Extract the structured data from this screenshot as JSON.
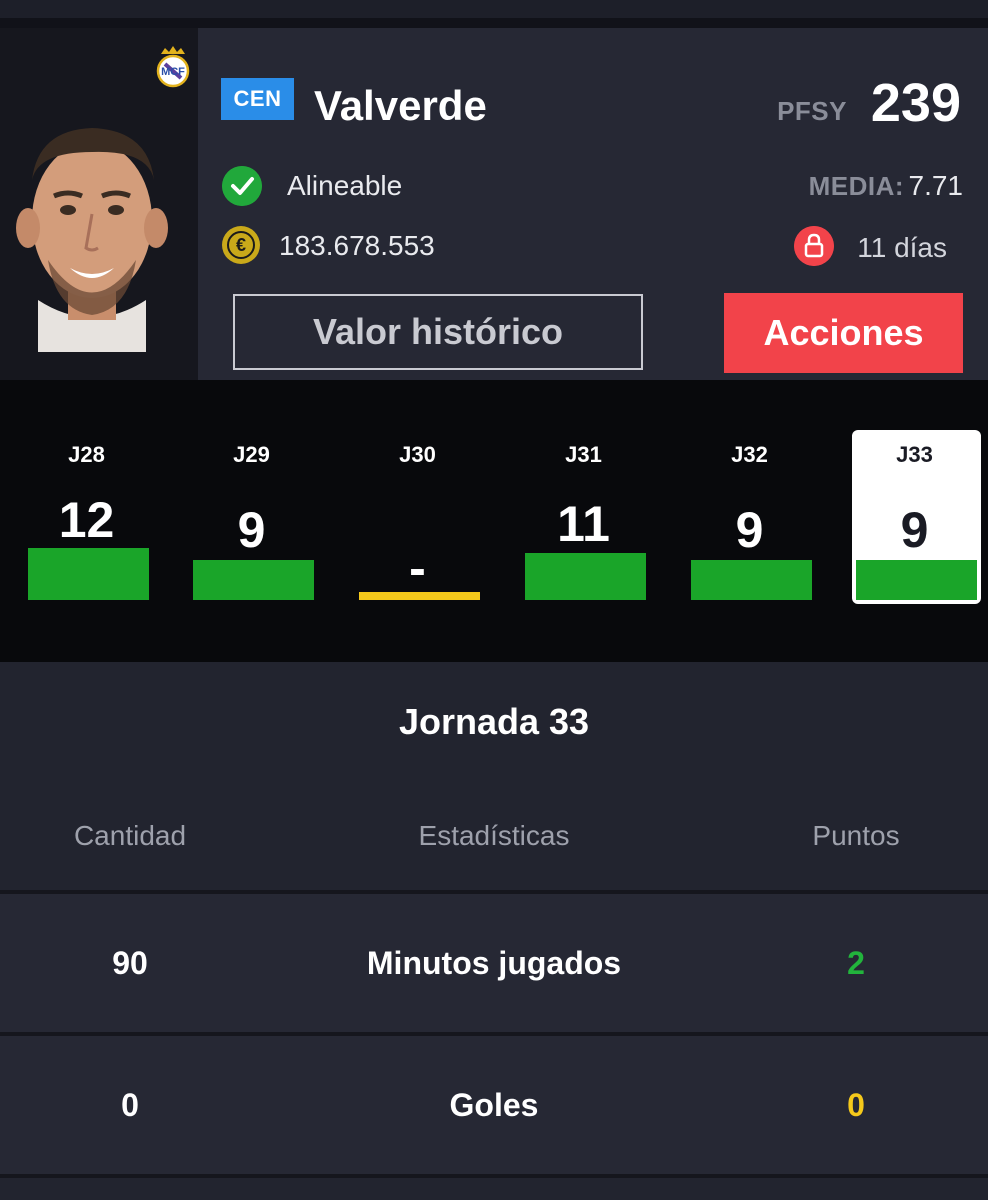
{
  "player": {
    "position": "CEN",
    "name": "Valverde",
    "pfsy_label": "PFSY",
    "pfsy_value": "239",
    "status": "Alineable",
    "media_label": "MEDIA:",
    "media_value": "7.71",
    "market_value": "183.678.553",
    "lock_days": "11 días",
    "club_crest": "real-madrid-crest-icon"
  },
  "buttons": {
    "historico": "Valor histórico",
    "acciones": "Acciones"
  },
  "rounds": [
    {
      "label": "J28",
      "points": "12",
      "level": 12,
      "color": "#1aa529"
    },
    {
      "label": "J29",
      "points": "9",
      "level": 9,
      "color": "#1aa529"
    },
    {
      "label": "J30",
      "points": "-",
      "level": 0,
      "color": "#f5c91b"
    },
    {
      "label": "J31",
      "points": "11",
      "level": 11,
      "color": "#1aa529"
    },
    {
      "label": "J32",
      "points": "9",
      "level": 9,
      "color": "#1aa529"
    },
    {
      "label": "J33",
      "points": "9",
      "level": 9,
      "color": "#1aa529",
      "selected": true
    }
  ],
  "detail": {
    "title": "Jornada 33",
    "headers": {
      "cantidad": "Cantidad",
      "estadisticas": "Estadísticas",
      "puntos": "Puntos"
    },
    "rows": [
      {
        "cantidad": "90",
        "estadistica": "Minutos jugados",
        "puntos": "2",
        "puntos_color": "#22b43c"
      },
      {
        "cantidad": "0",
        "estadistica": "Goles",
        "puntos": "0",
        "puntos_color": "#f5c91b"
      }
    ]
  },
  "colors": {
    "accent_red": "#f2434a",
    "badge_blue": "#2a8de8",
    "positive_green": "#1aa529",
    "neutral_yellow": "#f5c91b"
  }
}
